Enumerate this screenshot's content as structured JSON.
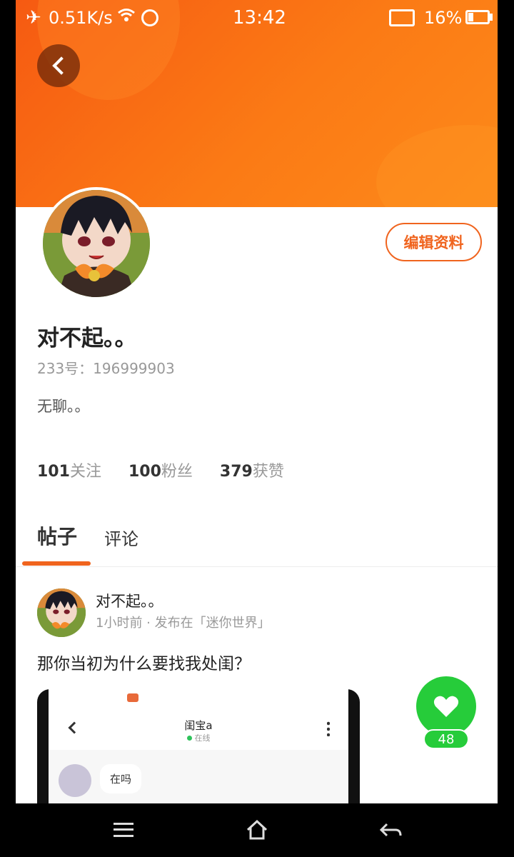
{
  "status_bar": {
    "speed": "0.51K/s",
    "time": "13:42",
    "battery": "16%"
  },
  "profile": {
    "nickname": "对不起。。",
    "uid": "233号：196999903",
    "bio": "无聊。。",
    "edit_label": "编辑资料",
    "stats": [
      {
        "count": "101",
        "label": "关注"
      },
      {
        "count": "100",
        "label": "粉丝"
      },
      {
        "count": "379",
        "label": "获赞"
      }
    ]
  },
  "tabs": {
    "posts": "帖子",
    "comments": "评论"
  },
  "post": {
    "author": "对不起。。",
    "meta": "1小时前 · 发布在「迷你世界」",
    "text": "那你当初为什么要找我处闺？",
    "like_count": "48",
    "image": {
      "chat_name": "闺宝a",
      "online": "在线",
      "message": "在吗"
    }
  },
  "colors": {
    "accent": "#f0641e",
    "header": "#fb7a15",
    "like": "#26cc3a"
  }
}
